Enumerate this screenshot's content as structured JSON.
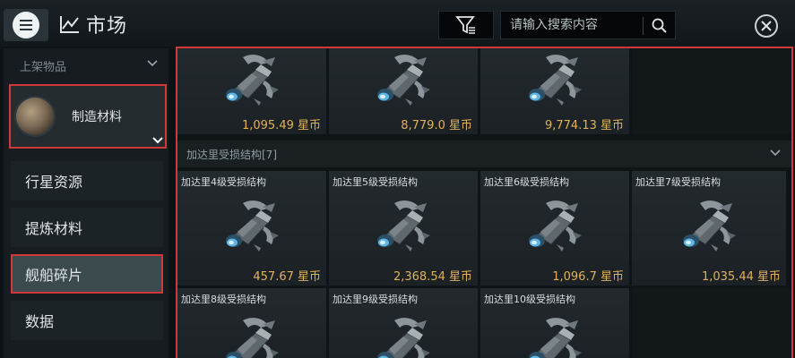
{
  "header": {
    "title": "市场",
    "search_placeholder": "请输入搜索内容"
  },
  "sidebar": {
    "category_header": "上架物品",
    "selected_category": "制造材料",
    "items": [
      {
        "label": "行星资源",
        "active": false
      },
      {
        "label": "提炼材料",
        "active": false
      },
      {
        "label": "舰船碎片",
        "active": true
      },
      {
        "label": "数据",
        "active": false
      }
    ]
  },
  "grid": {
    "top_row": [
      {
        "name": "",
        "price": "1,095.49 星币"
      },
      {
        "name": "",
        "price": "8,779.0 星币"
      },
      {
        "name": "",
        "price": "9,774.13 星币"
      }
    ],
    "section_title": "加达里受损结构[7]",
    "row2": [
      {
        "name": "加达里4级受损结构",
        "price": "457.67 星币"
      },
      {
        "name": "加达里5级受损结构",
        "price": "2,368.54 星币"
      },
      {
        "name": "加达里6级受损结构",
        "price": "1,096.7 星币"
      },
      {
        "name": "加达里7级受损结构",
        "price": "1,035.44 星币"
      }
    ],
    "row3": [
      {
        "name": "加达里8级受损结构",
        "price": ""
      },
      {
        "name": "加达里9级受损结构",
        "price": ""
      },
      {
        "name": "加达里10级受损结构",
        "price": ""
      }
    ]
  },
  "colors": {
    "highlight_border": "#d0383b",
    "price": "#e2b15a"
  }
}
